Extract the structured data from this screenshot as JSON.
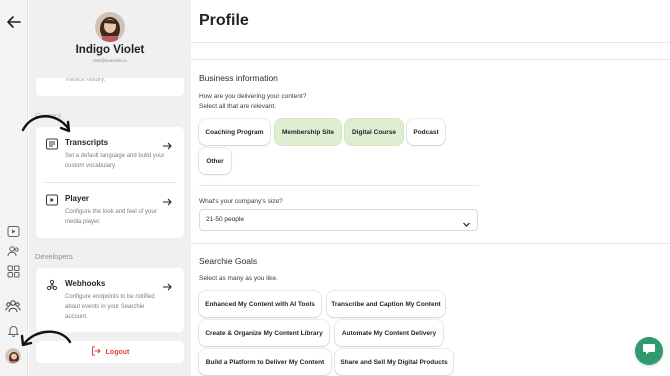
{
  "user": {
    "name": "Indigo Violet",
    "email": "test@searchie.io"
  },
  "sidebar": {
    "top_card_stub": "invoice history.",
    "content_label": "Content",
    "developers_label": "Developers",
    "items": [
      {
        "title": "Transcripts",
        "desc": "Set a default language and build your custom vocabulary.",
        "icon": "transcript-icon"
      },
      {
        "title": "Player",
        "desc": "Configure the look and feel of your media player.",
        "icon": "player-icon"
      },
      {
        "title": "Webhooks",
        "desc": "Configure endpoints to be notified about events in your Searchie account.",
        "icon": "webhook-icon"
      }
    ],
    "logout_label": "Logout"
  },
  "main": {
    "title": "Profile",
    "business": {
      "heading": "Business information",
      "question": "How are you delivering your content?",
      "hint": "Select all that are relevant.",
      "options": [
        {
          "label": "Coaching Program",
          "selected": false
        },
        {
          "label": "Membership Site",
          "selected": true
        },
        {
          "label": "Digital Course",
          "selected": true
        },
        {
          "label": "Podcast",
          "selected": false
        },
        {
          "label": "Other",
          "selected": false
        }
      ],
      "size_question": "What's your company's size?",
      "size_value": "21-50 people"
    },
    "goals": {
      "heading": "Searchie Goals",
      "hint": "Select as many as you like.",
      "options": [
        "Enhanced My Content with AI Tools",
        "Transcribe and Caption My Content",
        "Create & Organize My Content Library",
        "Automate My Content Delivery",
        "Build a Platform to Deliver My Content",
        "Share and Sell My Digital Products"
      ]
    }
  },
  "colors": {
    "selected_chip": "#dfeed3",
    "logout": "#e0443a",
    "chat": "#2f9a6c"
  }
}
